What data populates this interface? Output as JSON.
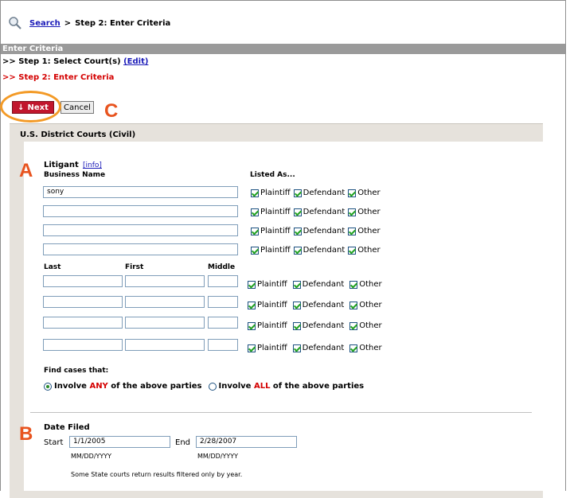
{
  "breadcrumb": {
    "link": "Search",
    "separator": ">",
    "current": "Step 2: Enter Criteria"
  },
  "header_bar": "Enter Criteria",
  "steps": {
    "step1_prefix": ">> Step 1: Select Court(s)",
    "step1_edit": "(Edit)",
    "step2": ">> Step 2: Enter Criteria"
  },
  "toolbar": {
    "next_label": "Next",
    "next_arrow": "↓",
    "cancel_label": "Cancel"
  },
  "annotations": {
    "a": "A",
    "b": "B",
    "c": "C",
    "accent_color": "#e8541f",
    "circle_color": "#f39a26"
  },
  "panel_title": "U.S. District Courts (Civil)",
  "litigant": {
    "title": "Litigant",
    "info": "[info]",
    "business_name_label": "Business Name",
    "listed_as_label": "Listed As...",
    "business_rows": [
      {
        "value": "sony"
      },
      {
        "value": ""
      },
      {
        "value": ""
      },
      {
        "value": ""
      }
    ],
    "last_label": "Last",
    "first_label": "First",
    "middle_label": "Middle",
    "person_rows": [
      {
        "last": "",
        "first": "",
        "middle": ""
      },
      {
        "last": "",
        "first": "",
        "middle": ""
      },
      {
        "last": "",
        "first": "",
        "middle": ""
      },
      {
        "last": "",
        "first": "",
        "middle": ""
      }
    ],
    "checkbox_labels": {
      "plaintiff": "Plaintiff",
      "defendant": "Defendant",
      "other": "Other"
    }
  },
  "find_cases": {
    "label": "Find cases that:",
    "any_pre": "Involve ",
    "any_word": "ANY",
    "any_post": " of the above parties",
    "all_pre": "Involve ",
    "all_word": "ALL",
    "all_post": " of the above parties",
    "selected": "any"
  },
  "date_filed": {
    "title": "Date Filed",
    "start_label": "Start",
    "start_value": "1/1/2005",
    "end_label": "End",
    "end_value": "2/28/2007",
    "format_hint": "MM/DD/YYYY",
    "note": "Some State courts return results filtered only by year."
  }
}
